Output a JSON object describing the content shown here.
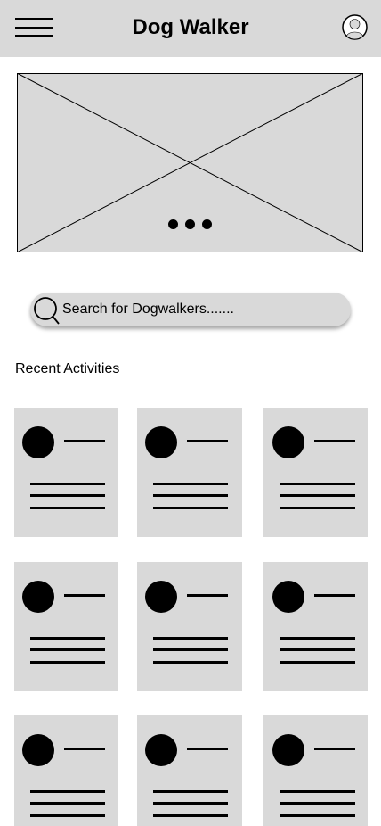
{
  "header": {
    "title": "Dog Walker",
    "menu_icon": "hamburger-menu-icon",
    "profile_icon": "user-profile-icon"
  },
  "hero": {
    "slide_count": 3
  },
  "search": {
    "placeholder": "Search for Dogwalkers.......",
    "value": "",
    "icon": "search-icon"
  },
  "recent": {
    "title": "Recent Activities",
    "card_count": 9
  },
  "colors": {
    "placeholder_fill": "#d9d9d9",
    "ink": "#000000",
    "background": "#ffffff"
  }
}
